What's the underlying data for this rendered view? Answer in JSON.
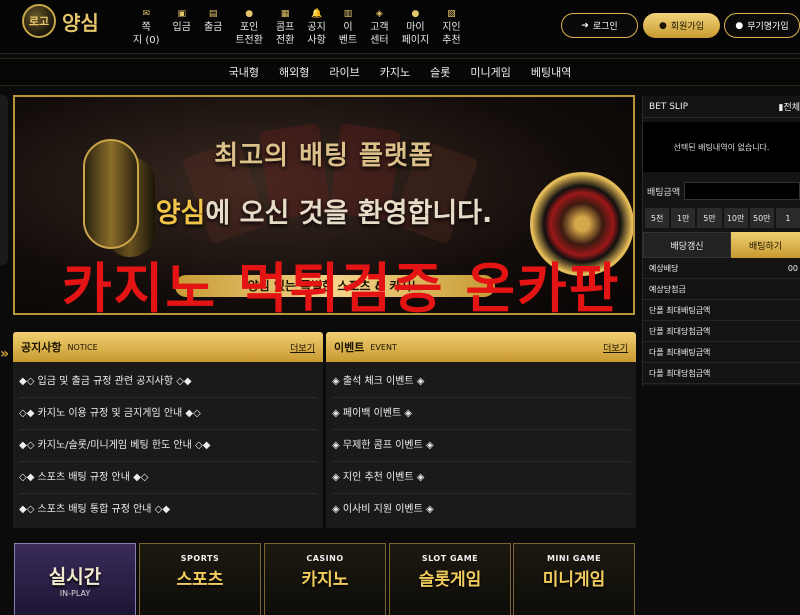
{
  "logo": {
    "badge": "로고",
    "text": "양심"
  },
  "nav": [
    {
      "icon": "✉",
      "label": "쪽",
      "label2": "지 (0)"
    },
    {
      "icon": "▣",
      "label": "입금"
    },
    {
      "icon": "▤",
      "label": "출금"
    },
    {
      "icon": "●",
      "label": "포인",
      "label2": "트전환"
    },
    {
      "icon": "▦",
      "label": "콤프",
      "label2": "전환"
    },
    {
      "icon": "🔔",
      "label": "공지",
      "label2": "사항"
    },
    {
      "icon": "▥",
      "label": "이",
      "label2": "벤트"
    },
    {
      "icon": "◈",
      "label": "고객",
      "label2": "센터"
    },
    {
      "icon": "●",
      "label": "마이",
      "label2": "페이지"
    },
    {
      "icon": "▧",
      "label": "지인",
      "label2": "추천"
    }
  ],
  "auth": {
    "login": "로그인",
    "join": "회원가입",
    "free": "무기명가입"
  },
  "subnav": [
    "국내형",
    "해외형",
    "라이브",
    "카지노",
    "슬롯",
    "미니게임",
    "베팅내역"
  ],
  "banner": {
    "line1": "최고의 배팅 플랫폼",
    "line2_highlight": "양심",
    "line2_rest": "에 오신 것을 환영합니다.",
    "line3": "양심 있는 특별한 스포츠 & 카지노"
  },
  "watermark": "카지노 먹튀검증 온카판",
  "notice": {
    "title": "공지사항",
    "en": "NOTICE",
    "more": "더보기",
    "items": [
      "◆◇ 입금 및 출금 규정 관련 공지사항 ◇◆",
      "◇◆ 카지노 이용 규정 및 금지게임 안내 ◆◇",
      "◆◇ 카지노/슬롯/미니게임 베팅 한도 안내 ◇◆",
      "◇◆ 스포츠 배팅 규정 안내 ◆◇",
      "◆◇ 스포츠 배팅 통합 규정 안내 ◇◆"
    ]
  },
  "event": {
    "title": "이벤트",
    "en": "EVENT",
    "more": "더보기",
    "items": [
      "◈ 출석 체크 이벤트 ◈",
      "◈ 페이백 이벤트 ◈",
      "◈ 무제한 콤프 이벤트 ◈",
      "◈ 지인 추천 이벤트 ◈",
      "◈ 이사비 지원 이벤트 ◈"
    ]
  },
  "games": [
    {
      "small": "",
      "big": "실시간",
      "sub": "IN-PLAY"
    },
    {
      "small": "SPORTS",
      "big": "스포츠"
    },
    {
      "small": "CASINO",
      "big": "카지노"
    },
    {
      "small": "SLOT GAME",
      "big": "슬롯게임"
    },
    {
      "small": "MINI GAME",
      "big": "미니게임"
    }
  ],
  "slip": {
    "title": "BET SLIP",
    "clear": "전체",
    "empty": "선택된 배팅내역이 없습니다.",
    "amount_label": "배팅금액",
    "chips": [
      "5천",
      "1만",
      "5만",
      "10만",
      "50만",
      "1"
    ],
    "tab_refresh": "배당갱신",
    "tab_bet": "배팅하기",
    "rows": [
      {
        "label": "예상배당",
        "value": "00"
      },
      {
        "label": "예상당첨금",
        "value": ""
      },
      {
        "label": "단폴 최대배팅금액",
        "value": ""
      },
      {
        "label": "단폴 최대당첨금액",
        "value": ""
      },
      {
        "label": "다폴 최대배팅금액",
        "value": ""
      },
      {
        "label": "다폴 최대당첨금액",
        "value": ""
      }
    ]
  }
}
